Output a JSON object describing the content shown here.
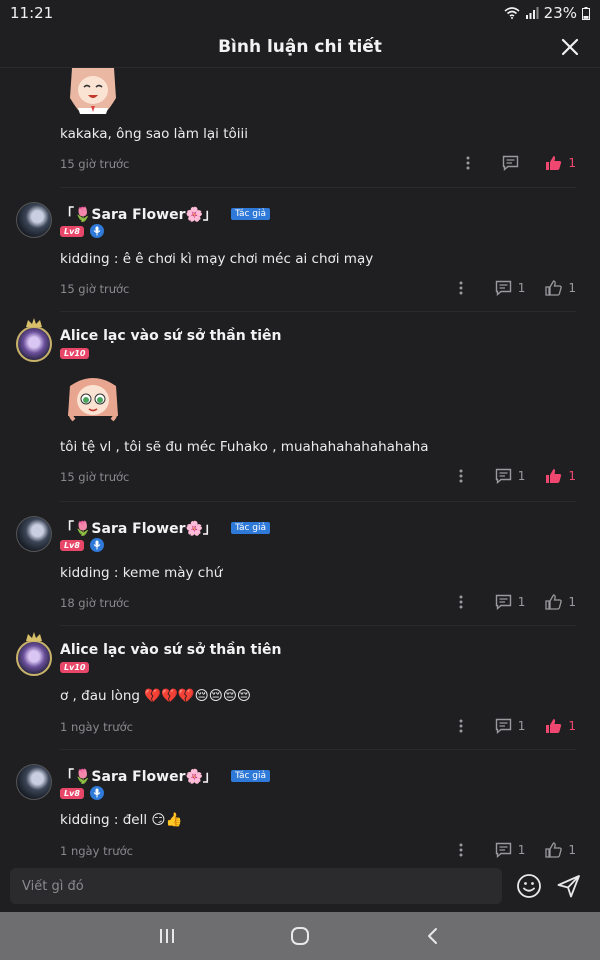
{
  "status": {
    "time": "11:21",
    "battery": "23%"
  },
  "header": {
    "title": "Bình luận chi tiết"
  },
  "comments": [
    {
      "text": "kakaka, ông sao làm lại tôiii",
      "time": "15 giờ trước",
      "reply_count": "",
      "like_count": "1",
      "liked": true
    },
    {
      "name": "「🌷Sara Flower🌸」",
      "author_badge": "Tác giả",
      "level": "Lv8",
      "text": "kidding : ê ê chơi kì mạy chơi méc ai chơi mạy",
      "time": "15 giờ trước",
      "reply_count": "1",
      "like_count": "1",
      "liked": false
    },
    {
      "name": "Alice lạc vào sứ sở thần tiên",
      "level": "Lv10",
      "text": "tôi tệ vl , tôi sẽ đu méc Fuhako , muahahahahahahaha",
      "time": "15 giờ trước",
      "reply_count": "1",
      "like_count": "1",
      "liked": true
    },
    {
      "name": "「🌷Sara Flower🌸」",
      "author_badge": "Tác giả",
      "level": "Lv8",
      "text": "kidding : keme mày chứ",
      "time": "18 giờ trước",
      "reply_count": "1",
      "like_count": "1",
      "liked": false
    },
    {
      "name": "Alice lạc vào sứ sở thần tiên",
      "level": "Lv10",
      "text": "ơ , đau lòng 💔💔💔😔😔😔😔",
      "time": "1 ngày trước",
      "reply_count": "1",
      "like_count": "1",
      "liked": true
    },
    {
      "name": "「🌷Sara Flower🌸」",
      "author_badge": "Tác giả",
      "level": "Lv8",
      "text": "kidding : đell 😏👍",
      "time": "1 ngày trước",
      "reply_count": "1",
      "like_count": "1",
      "liked": false
    }
  ],
  "composer": {
    "placeholder": "Viết gì đó"
  },
  "colors": {
    "background": "#1f1f21",
    "liked": "#ef476f",
    "author_badge": "#2f7ad8",
    "level_badge": "#e8476a",
    "muted": "#8a8a8e"
  },
  "icons": [
    "wifi-icon",
    "signal-icon",
    "battery-icon",
    "close-icon",
    "more-icon",
    "comment-icon",
    "like-icon",
    "mic-icon",
    "emoji-icon",
    "send-icon",
    "recent-apps-icon",
    "home-icon",
    "back-icon"
  ]
}
